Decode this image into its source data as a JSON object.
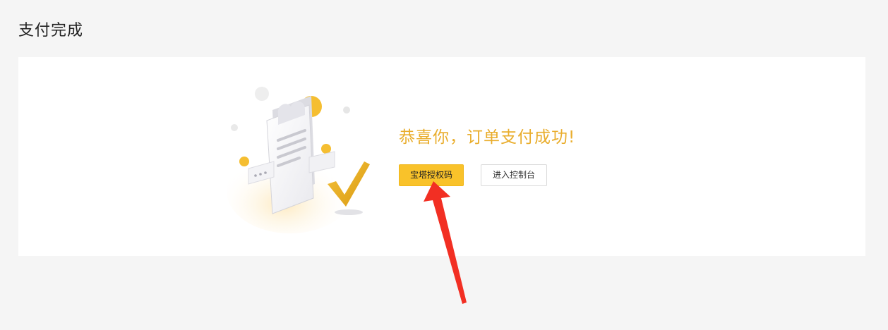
{
  "page": {
    "title": "支付完成"
  },
  "result": {
    "message": "恭喜你，订单支付成功!",
    "primary_button_label": "宝塔授权码",
    "secondary_button_label": "进入控制台"
  },
  "colors": {
    "accent": "#f9c22a",
    "message": "#e9ad2c",
    "annotation_arrow": "#f22f23",
    "page_background": "#f5f5f5",
    "card_background": "#ffffff"
  },
  "icons": {
    "illustration": "payment-success-illustration",
    "annotation": "red-arrow-annotation"
  }
}
